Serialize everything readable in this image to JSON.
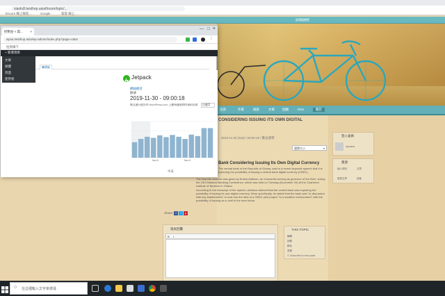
{
  "background_browser": {
    "tabs": [
      "Encore 線上報名...",
      "Google",
      "寫寫 線上..."
    ],
    "url": "xiaolu8.twsthop.asia/forum/topic/...",
    "bookmark": "拉頁線下",
    "site_topbar": "部落格總覽"
  },
  "site_nav": [
    "首頁",
    "作者",
    "檢索",
    "文章",
    "回顧",
    "RSS",
    "關於"
  ],
  "article": {
    "heading": "CONSIDERING ISSUING ITS OWN DIGITAL",
    "meta": "2019-11-30 (Sat) / 09:00:18 / 數位貨幣",
    "select_label": "選擇大小",
    "title": "Bank Considering Issuing Its Own Digital Currency",
    "para1": "The central bank of the Republic of Ghana, said in a recent keynode speech that it is exploring the possibility of issuing a central bank digital currency (CBDC).",
    "para2": "The keynote address was given by Ernest Addison, an economist serving as governor of the BoG, during the 23rd National Banking Conference, which was held on Tuesday (November 26) at the Chartered Institute of Bankers in Ghana.",
    "para3": "According to the transcript of the speech, Addison claimed that the central bank was exploring the possibility of issuing its own digital currency: More specifically, he stated that the bank was \"in discussion with key stakeholders\" to look into the idea of a CBDC pilot project \"in a sandbox environment\" with the possibility of issuing an e-cedi in the near future.",
    "share_label": "Share:",
    "share_buttons": [
      "f",
      "t",
      "p"
    ]
  },
  "sidebar": {
    "login_widget": "登入會員",
    "login_name": "myname",
    "tools_widget": "資源",
    "tools": [
      "個人資料",
      "文章",
      "發表文章",
      "訪客"
    ],
    "topic_widget": "THIS TOPIC",
    "topic_links": [
      "編輯",
      "回覆",
      "移除",
      "書籤"
    ],
    "subscribe": "Subscribe to new posts"
  },
  "comment": {
    "label": "發表回覆",
    "toolbar": [
      "B",
      "i",
      "link",
      "img",
      "code"
    ]
  },
  "fg_window": {
    "tab_title": "控制台 < 寫...",
    "address": "wpsa.twsthop.asia/wp-admin/index.php?page=stats",
    "bookmark": "拉頁線下",
    "adminbar_item": "+ 新增項目",
    "dropdown": [
      "文章",
      "媒體",
      "頁面",
      "使用者"
    ],
    "tab_active": "儀表板",
    "jetpack": "Jetpack",
    "stats_title": "網站統計",
    "stats_sub": "數據",
    "datetime": "2019-11-30 - 09:00:18",
    "notice": "無法進行統計的 WordPress.com 上擁有權限時的資料存取",
    "period_buttons": [
      "日",
      "週",
      "月"
    ],
    "chart_labels": {
      "left": "Nov 5",
      "right": "Nov 9"
    },
    "chart_footer": "今天"
  },
  "chart_data": {
    "type": "bar",
    "categories": [
      "1",
      "2",
      "3",
      "4",
      "5",
      "6",
      "7",
      "8",
      "9",
      "10",
      "11",
      "12",
      "13"
    ],
    "values": [
      43,
      52,
      58,
      55,
      62,
      57,
      63,
      58,
      52,
      64,
      60,
      82,
      82
    ],
    "ylim": [
      0,
      100
    ],
    "highlight_range": [
      0,
      2
    ],
    "grid": true
  },
  "taskbar": {
    "search_placeholder": "在這裡輸入文字來搜尋",
    "icons": [
      "task-view-icon",
      "edge-icon",
      "folder-icon",
      "store-icon",
      "mail-icon",
      "chrome-icon",
      "settings-icon"
    ]
  },
  "colors": {
    "accent": "#64b0b8",
    "jetpack_green": "#2fb41f",
    "bar_blue": "#8fb4cf"
  }
}
